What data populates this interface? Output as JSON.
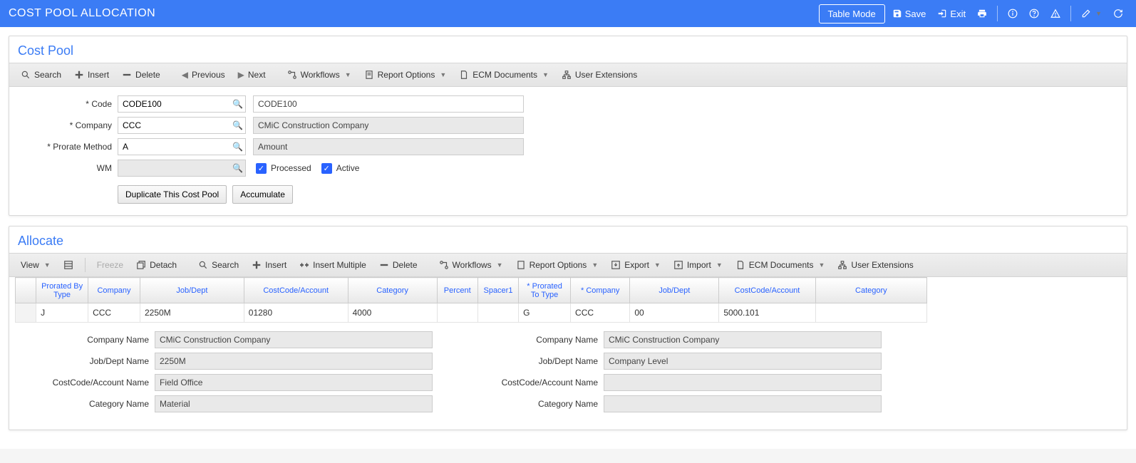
{
  "header": {
    "title": "COST POOL ALLOCATION",
    "table_mode": "Table Mode",
    "save": "Save",
    "exit": "Exit"
  },
  "cost_pool": {
    "title": "Cost Pool",
    "toolbar": {
      "search": "Search",
      "insert": "Insert",
      "delete": "Delete",
      "previous": "Previous",
      "next": "Next",
      "workflows": "Workflows",
      "report_options": "Report Options",
      "ecm_documents": "ECM Documents",
      "user_extensions": "User Extensions"
    },
    "fields": {
      "code_label": "Code",
      "code_value": "CODE100",
      "code_display": "CODE100",
      "company_label": "Company",
      "company_value": "CCC",
      "company_display": "CMiC Construction Company",
      "prorate_label": "Prorate Method",
      "prorate_value": "A",
      "prorate_display": "Amount",
      "wm_label": "WM",
      "wm_value": "",
      "processed_label": "Processed",
      "active_label": "Active"
    },
    "buttons": {
      "duplicate": "Duplicate This Cost Pool",
      "accumulate": "Accumulate"
    }
  },
  "allocate": {
    "title": "Allocate",
    "toolbar": {
      "view": "View",
      "freeze": "Freeze",
      "detach": "Detach",
      "search": "Search",
      "insert": "Insert",
      "insert_multiple": "Insert Multiple",
      "delete": "Delete",
      "workflows": "Workflows",
      "report_options": "Report Options",
      "export": "Export",
      "import": "Import",
      "ecm_documents": "ECM Documents",
      "user_extensions": "User Extensions"
    },
    "columns": {
      "prorated_by_type": "Prorated By Type",
      "company": "Company",
      "job_dept": "Job/Dept",
      "costcode_account": "CostCode/Account",
      "category": "Category",
      "percent": "Percent",
      "spacer1": "Spacer1",
      "prorated_to_type": "Prorated To Type",
      "company2": "Company",
      "job_dept2": "Job/Dept",
      "costcode_account2": "CostCode/Account",
      "category2": "Category"
    },
    "rows": [
      {
        "prorated_by_type": "J",
        "company": "CCC",
        "job_dept": "2250M",
        "costcode_account": "01280",
        "category": "4000",
        "percent": "",
        "spacer1": "",
        "prorated_to_type": "G",
        "company2": "CCC",
        "job_dept2": "00",
        "costcode_account2": "5000.101",
        "category2": ""
      }
    ],
    "details": {
      "left": {
        "company_name_label": "Company Name",
        "company_name": "CMiC Construction Company",
        "job_dept_name_label": "Job/Dept Name",
        "job_dept_name": "2250M",
        "costcode_name_label": "CostCode/Account Name",
        "costcode_name": "Field Office",
        "category_name_label": "Category Name",
        "category_name": "Material"
      },
      "right": {
        "company_name_label": "Company Name",
        "company_name": "CMiC Construction Company",
        "job_dept_name_label": "Job/Dept Name",
        "job_dept_name": "Company Level",
        "costcode_name_label": "CostCode/Account Name",
        "costcode_name": "",
        "category_name_label": "Category Name",
        "category_name": ""
      }
    }
  }
}
